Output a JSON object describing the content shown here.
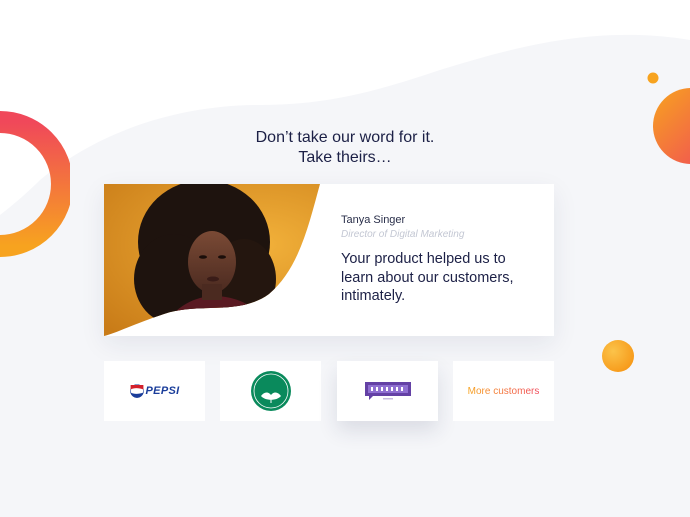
{
  "heading": {
    "line1": "Don’t take our word for it.",
    "line2": "Take theirs…"
  },
  "testimonial": {
    "name": "Tanya Singer",
    "role": "Director of Digital Marketing",
    "quote": "Your product helped us to learn about our customers, intimately."
  },
  "customers": {
    "logos": [
      {
        "name": "PEPSI",
        "icon": "pepsi-logo"
      },
      {
        "name": "THE BODY SHOP",
        "icon": "body-shop-logo"
      },
      {
        "name": "twitch",
        "icon": "twitch-logo"
      }
    ],
    "more_label": "More customers"
  },
  "colors": {
    "heading": "#1c2046",
    "accent_orange": "#f7a31f",
    "accent_red": "#f0485a",
    "twitch_purple": "#6441a5",
    "body_shop_green": "#0a8a5c"
  }
}
